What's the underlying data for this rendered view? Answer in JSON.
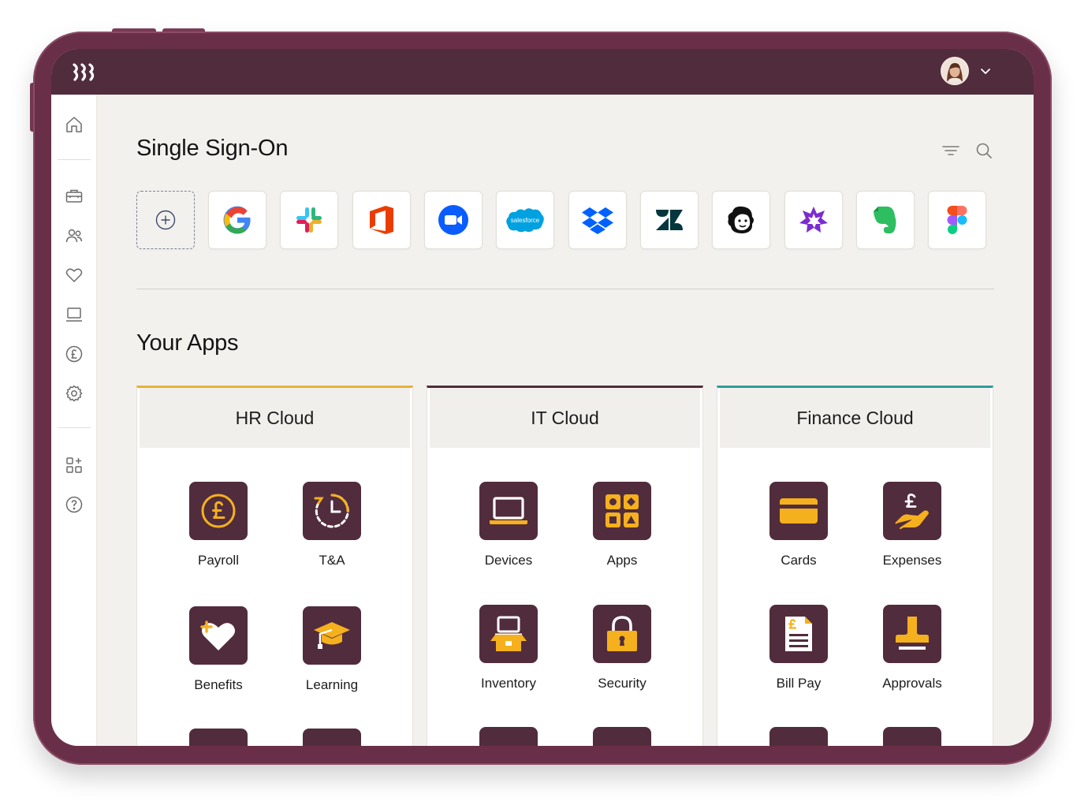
{
  "colors": {
    "frame": "#6a2f48",
    "topbar": "#512c3d",
    "app_tile": "#512c3d",
    "icon_accent": "#f5b01d",
    "hr_accent": "#e8b13a",
    "it_accent": "#512c3d",
    "finance_accent": "#2f9c9a",
    "screen_bg": "#f3f1ed"
  },
  "topbar": {
    "logo_icon": "rippling-logo-icon",
    "avatar_icon": "user-avatar",
    "menu_icon": "chevron-down-icon"
  },
  "sidebar": {
    "items": [
      {
        "icon": "home-icon"
      },
      {
        "icon": "briefcase-icon"
      },
      {
        "icon": "people-icon"
      },
      {
        "icon": "heart-icon"
      },
      {
        "icon": "laptop-icon"
      },
      {
        "icon": "pound-icon"
      },
      {
        "icon": "settings-icon"
      },
      {
        "icon": "apps-add-icon"
      },
      {
        "icon": "help-icon"
      }
    ]
  },
  "sso": {
    "title": "Single Sign-On",
    "tools": [
      "filter-icon",
      "search-icon"
    ],
    "apps": [
      {
        "name": "add",
        "icon": "add-circle-icon"
      },
      {
        "name": "google",
        "icon": "google-logo"
      },
      {
        "name": "slack",
        "icon": "slack-logo"
      },
      {
        "name": "office",
        "icon": "office-logo"
      },
      {
        "name": "zoom",
        "icon": "zoom-logo"
      },
      {
        "name": "salesforce",
        "icon": "salesforce-logo",
        "logo_text": "salesforce"
      },
      {
        "name": "dropbox",
        "icon": "dropbox-logo"
      },
      {
        "name": "zendesk",
        "icon": "zendesk-logo"
      },
      {
        "name": "mailchimp",
        "icon": "mailchimp-logo"
      },
      {
        "name": "clickup",
        "icon": "burst-logo"
      },
      {
        "name": "evernote",
        "icon": "evernote-logo"
      },
      {
        "name": "figma",
        "icon": "figma-logo"
      }
    ]
  },
  "your_apps": {
    "title": "Your Apps",
    "clouds": [
      {
        "title": "HR Cloud",
        "apps": [
          {
            "label": "Payroll",
            "icon": "pound-coin-icon"
          },
          {
            "label": "T&A",
            "icon": "clock-icon"
          },
          {
            "label": "Benefits",
            "icon": "heart-plus-icon"
          },
          {
            "label": "Learning",
            "icon": "graduation-cap-icon"
          }
        ]
      },
      {
        "title": "IT Cloud",
        "apps": [
          {
            "label": "Devices",
            "icon": "laptop-icon"
          },
          {
            "label": "Apps",
            "icon": "app-grid-icon"
          },
          {
            "label": "Inventory",
            "icon": "inventory-box-icon"
          },
          {
            "label": "Security",
            "icon": "padlock-icon"
          }
        ]
      },
      {
        "title": "Finance Cloud",
        "apps": [
          {
            "label": "Cards",
            "icon": "credit-card-icon"
          },
          {
            "label": "Expenses",
            "icon": "hand-pound-icon"
          },
          {
            "label": "Bill Pay",
            "icon": "bill-icon"
          },
          {
            "label": "Approvals",
            "icon": "stamp-icon"
          }
        ]
      }
    ]
  }
}
